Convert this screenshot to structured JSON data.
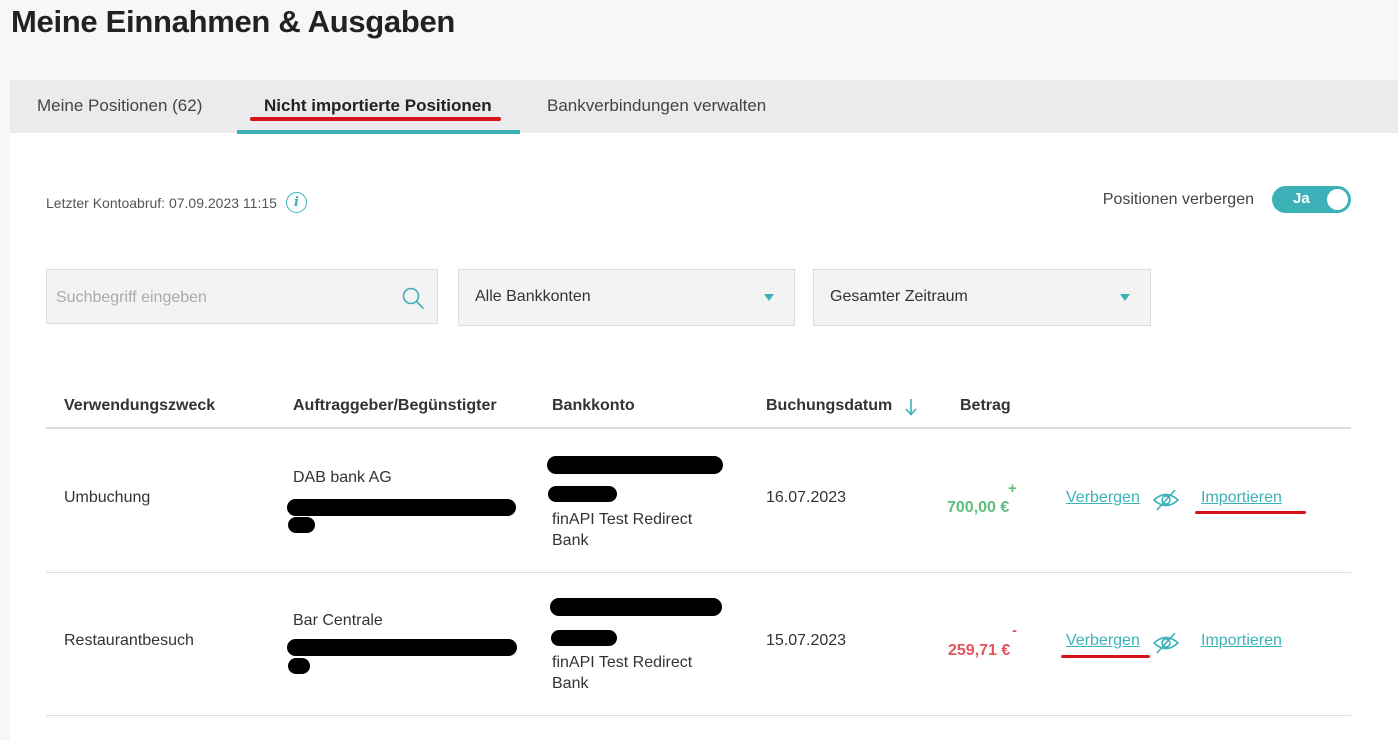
{
  "page": {
    "title": "Meine Einnahmen & Ausgaben"
  },
  "tabs": [
    {
      "label": "Meine Positionen (62)",
      "active": false
    },
    {
      "label": "Nicht importierte Positionen",
      "active": true
    },
    {
      "label": "Bankverbindungen verwalten",
      "active": false
    }
  ],
  "status": {
    "last_fetch": "Letzter Kontoabruf: 07.09.2023 11:15",
    "info_icon": "i"
  },
  "hide_toggle": {
    "label": "Positionen verbergen",
    "value": "Ja"
  },
  "filters": {
    "search_placeholder": "Suchbegriff eingeben",
    "account_select": "Alle Bankkonten",
    "period_select": "Gesamter Zeitraum"
  },
  "table": {
    "headers": {
      "purpose": "Verwendungszweck",
      "payee": "Auftraggeber/Begünstigter",
      "account": "Bankkonto",
      "date": "Buchungsdatum",
      "amount": "Betrag"
    },
    "rows": [
      {
        "purpose": "Umbuchung",
        "payee": "DAB bank AG",
        "account_line1": "finAPI Test Redirect",
        "account_line2": "Bank",
        "date": "16.07.2023",
        "sign": "+",
        "amount": "700,00 €",
        "hide_label": "Verbergen",
        "import_label": "Importieren"
      },
      {
        "purpose": "Restaurantbesuch",
        "payee": "Bar Centrale",
        "account_line1": "finAPI Test Redirect",
        "account_line2": "Bank",
        "date": "15.07.2023",
        "sign": "-",
        "amount": "259,71 €",
        "hide_label": "Verbergen",
        "import_label": "Importieren"
      }
    ]
  },
  "colors": {
    "accent": "#3cb2b8",
    "positive": "#5fbf7a",
    "negative": "#e2535a",
    "annotation": "#d8141b"
  },
  "icons": [
    "info-icon",
    "search-icon",
    "chevron-down-icon",
    "sort-down-arrow-icon",
    "eye-slash-icon"
  ]
}
